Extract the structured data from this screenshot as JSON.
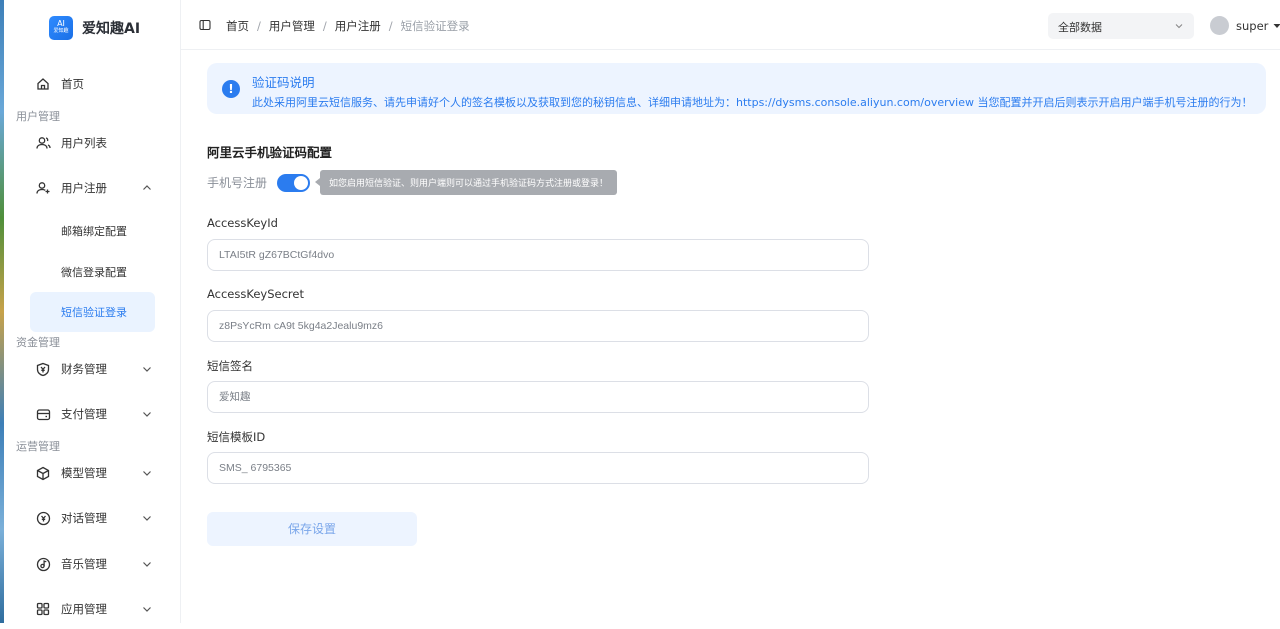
{
  "app": {
    "logo_badge_top": "AI",
    "logo_badge_bottom": "爱知趣",
    "logo_text": "爱知趣AI"
  },
  "sidebar": {
    "home": "首页",
    "section_user": "用户管理",
    "user_list": "用户列表",
    "user_register": "用户注册",
    "sub_email": "邮箱绑定配置",
    "sub_wechat": "微信登录配置",
    "sub_sms": "短信验证登录",
    "section_funds": "资金管理",
    "finance": "财务管理",
    "payment": "支付管理",
    "section_ops": "运营管理",
    "model": "模型管理",
    "dialog": "对话管理",
    "music": "音乐管理",
    "app_mgmt": "应用管理"
  },
  "breadcrumb": [
    "首页",
    "用户管理",
    "用户注册",
    "短信验证登录"
  ],
  "header": {
    "select_value": "全部数据",
    "username": "super"
  },
  "alert": {
    "title": "验证码说明",
    "desc": "此处采用阿里云短信服务、请先申请好个人的签名模板以及获取到您的秘钥信息、详细申请地址为：https://dysms.console.aliyun.com/overview 当您配置并开启后则表示开启用户端手机号注册的行为！"
  },
  "form": {
    "title": "阿里云手机验证码配置",
    "switch_label": "手机号注册",
    "switch_on": true,
    "switch_tip": "如您启用短信验证、则用户端则可以通过手机验证码方式注册或登录！",
    "access_key_id_label": "AccessKeyId",
    "access_key_id_value": "LTAI5tR      gZ67BCtGf4dvo",
    "access_key_secret_label": "AccessKeySecret",
    "access_key_secret_value": "z8PsYcRm   cA9t   5kg4a2Jealu9mz6",
    "sign_label": "短信签名",
    "sign_value": "爱知趣",
    "template_label": "短信模板ID",
    "template_value": "SMS_   6795365",
    "save_label": "保存设置"
  }
}
